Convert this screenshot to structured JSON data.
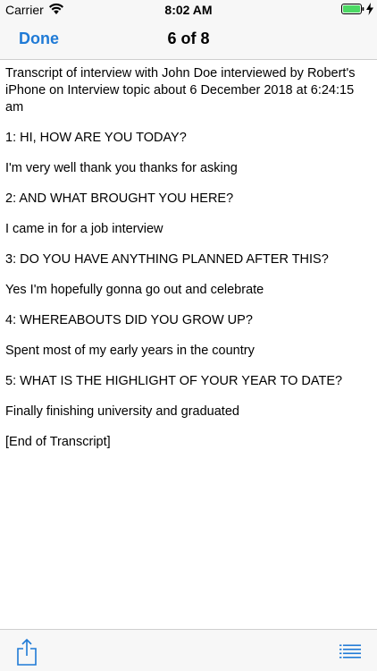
{
  "status_bar": {
    "carrier": "Carrier",
    "time": "8:02 AM",
    "wifi_icon": "wifi-icon",
    "battery_icon": "battery-icon",
    "battery_color": "#4cd964"
  },
  "nav": {
    "done_label": "Done",
    "title": "6 of 8",
    "accent_color": "#1f7ad6"
  },
  "transcript": {
    "intro": "Transcript of interview with John Doe interviewed by Robert's iPhone on Interview topic about 6 December 2018 at 6:24:15 am",
    "lines": [
      "1: HI, HOW ARE YOU TODAY?",
      "I'm very well thank you thanks for asking",
      "2: AND WHAT BROUGHT YOU HERE?",
      "I came in for a job interview",
      "3: DO YOU HAVE ANYTHING PLANNED AFTER THIS?",
      "Yes I'm hopefully gonna go out and celebrate",
      "4: WHEREABOUTS DID YOU GROW UP?",
      "Spent most of my early years in the country",
      "5: WHAT IS THE HIGHLIGHT OF YOUR YEAR TO DATE?",
      "Finally finishing university and graduated"
    ],
    "end": "[End of Transcript]"
  },
  "toolbar": {
    "share_icon": "share-icon",
    "list_icon": "list-icon"
  }
}
